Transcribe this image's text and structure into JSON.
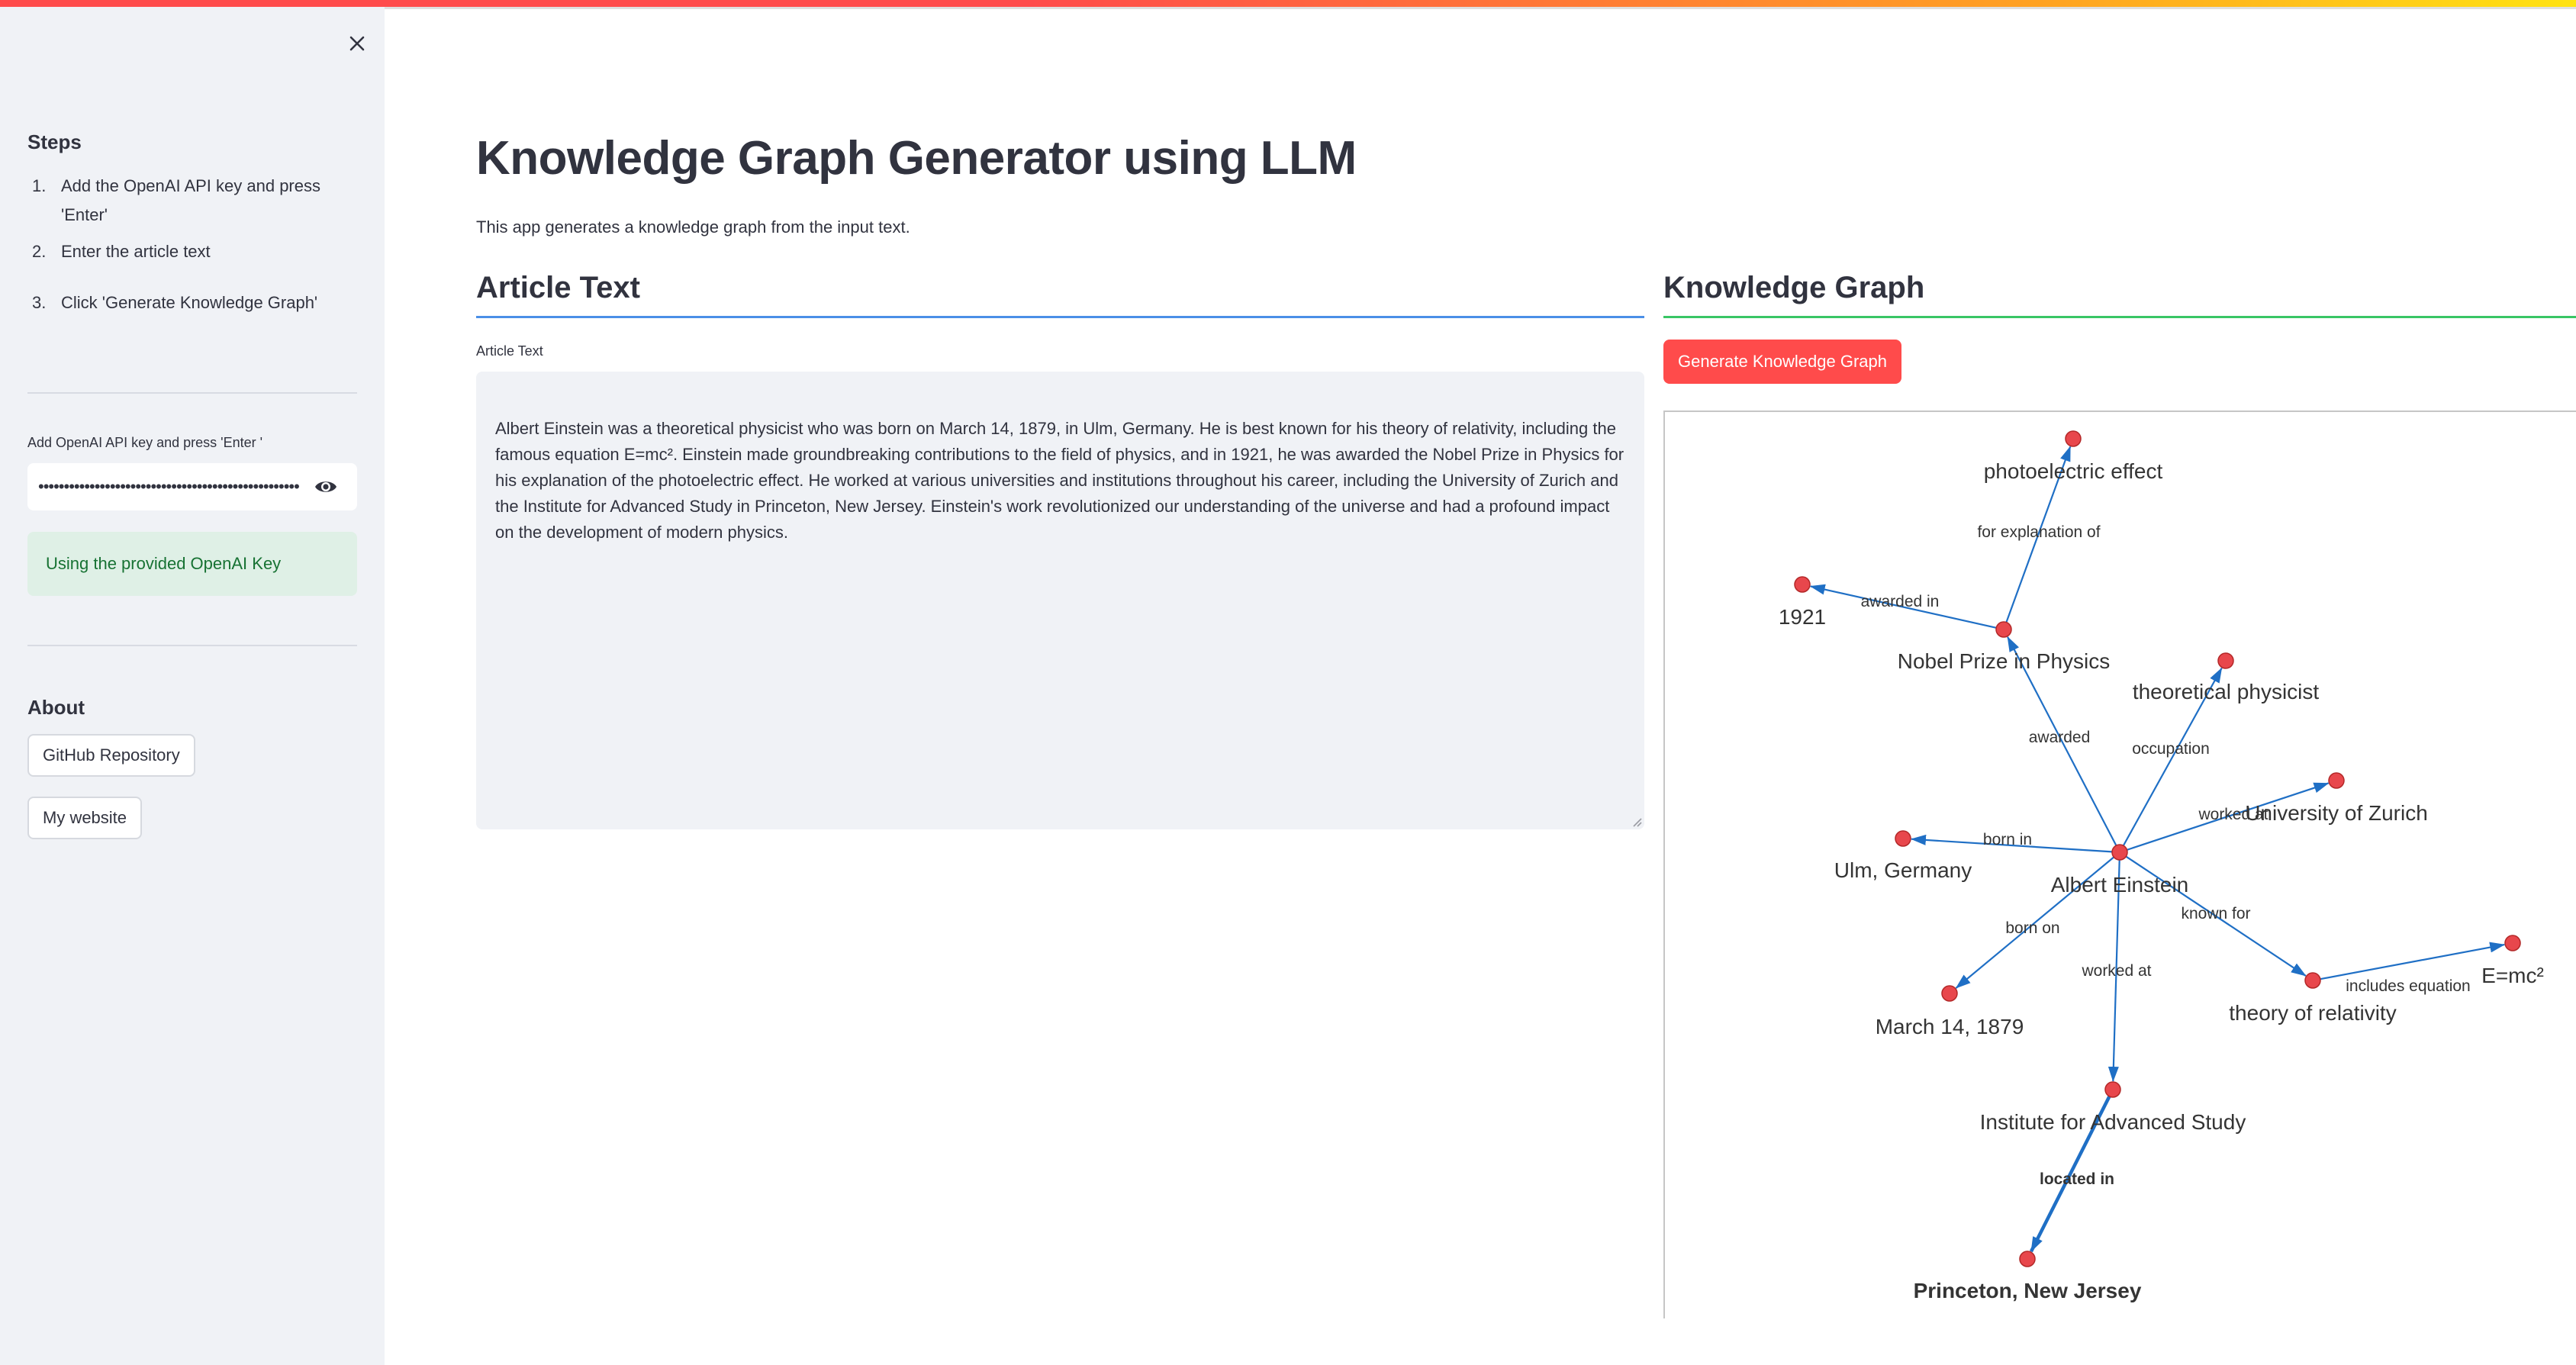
{
  "sidebar": {
    "steps_heading": "Steps",
    "steps": [
      {
        "num": "1.",
        "text": "Add the OpenAI API key and press 'Enter'"
      },
      {
        "num": "2.",
        "text": "Enter the article text"
      },
      {
        "num": "3.",
        "text": "Click 'Generate Knowledge Graph'"
      }
    ],
    "api_key_label": "Add OpenAI API key and press 'Enter '",
    "api_key_value": "•••••••••••••••••••••••••••••••••••••••••••••••••••",
    "success_message": "Using the provided OpenAI Key",
    "about_heading": "About",
    "links": [
      "GitHub Repository",
      "My website"
    ]
  },
  "main": {
    "title": "Knowledge Graph Generator using LLM",
    "subtitle": "This app generates a knowledge graph from the input text.",
    "article_header": "Article Text",
    "article_label": "Article Text",
    "article_text": "Albert Einstein was a theoretical physicist who was born on March 14, 1879, in Ulm, Germany. He is best known for his theory of relativity, including the famous equation E=mc². Einstein made groundbreaking contributions to the field of physics, and in 1921, he was awarded the Nobel Prize in Physics for his explanation of the photoelectric effect. He worked at various universities and institutions throughout his career, including the University of Zurich and the Institute for Advanced Study in Princeton, New Jersey. Einstein's work revolutionized our understanding of the universe and had a profound impact on the development of modern physics.",
    "graph_header": "Knowledge Graph",
    "generate_button": "Generate Knowledge Graph"
  },
  "graph": {
    "node_color": "#e8474c",
    "edge_color": "#1f6fc5",
    "nodes": [
      {
        "id": "einstein",
        "label": "Albert Einstein"
      },
      {
        "id": "photo",
        "label": "photoelectric effect"
      },
      {
        "id": "y1921",
        "label": "1921"
      },
      {
        "id": "nobel",
        "label": "Nobel Prize in Physics"
      },
      {
        "id": "theo",
        "label": "theoretical physicist"
      },
      {
        "id": "zurich",
        "label": "University of Zurich"
      },
      {
        "id": "ulm",
        "label": "Ulm, Germany"
      },
      {
        "id": "march",
        "label": "March 14, 1879"
      },
      {
        "id": "relativity",
        "label": "theory of relativity"
      },
      {
        "id": "emc",
        "label": "E=mc²"
      },
      {
        "id": "ias",
        "label": "Institute for Advanced Study"
      },
      {
        "id": "princeton",
        "label": "Princeton, New Jersey"
      }
    ],
    "edges": [
      {
        "from": "nobel",
        "to": "photo",
        "label": "for explanation of"
      },
      {
        "from": "nobel",
        "to": "y1921",
        "label": "awarded in"
      },
      {
        "from": "einstein",
        "to": "nobel",
        "label": "awarded"
      },
      {
        "from": "einstein",
        "to": "theo",
        "label": "occupation"
      },
      {
        "from": "einstein",
        "to": "zurich",
        "label": "worked at"
      },
      {
        "from": "einstein",
        "to": "ulm",
        "label": "born in"
      },
      {
        "from": "einstein",
        "to": "march",
        "label": "born on"
      },
      {
        "from": "einstein",
        "to": "relativity",
        "label": "known for"
      },
      {
        "from": "relativity",
        "to": "emc",
        "label": "includes equation"
      },
      {
        "from": "einstein",
        "to": "ias",
        "label": "worked at"
      },
      {
        "from": "ias",
        "to": "princeton",
        "label": "located in",
        "highlighted": true
      }
    ]
  }
}
